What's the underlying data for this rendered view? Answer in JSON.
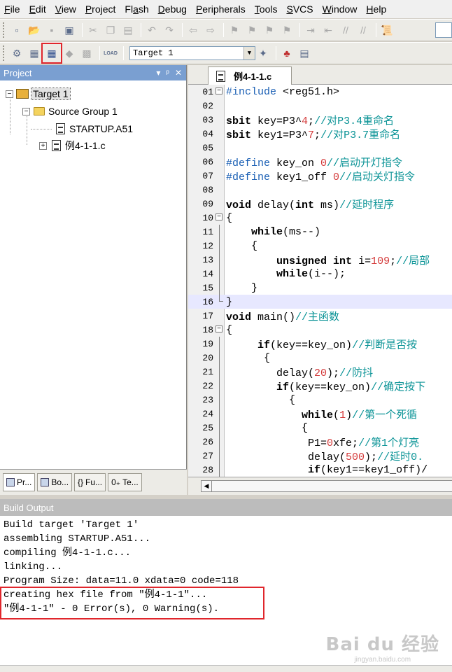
{
  "menu": [
    {
      "label": "File",
      "u": "F",
      "rest": "ile"
    },
    {
      "label": "Edit",
      "u": "E",
      "rest": "dit"
    },
    {
      "label": "View",
      "u": "V",
      "rest": "iew"
    },
    {
      "label": "Project",
      "u": "P",
      "rest": "roject"
    },
    {
      "label": "Flash",
      "u": "a",
      "pre": "Fl",
      "rest": "sh"
    },
    {
      "label": "Debug",
      "u": "D",
      "rest": "ebug"
    },
    {
      "label": "Peripherals",
      "u": "P",
      "rest": "eripherals"
    },
    {
      "label": "Tools",
      "u": "T",
      "rest": "ools"
    },
    {
      "label": "SVCS",
      "u": "S",
      "rest": "VCS"
    },
    {
      "label": "Window",
      "u": "W",
      "rest": "indow"
    },
    {
      "label": "Help",
      "u": "H",
      "rest": "elp"
    }
  ],
  "toolbar2": {
    "target": "Target 1",
    "load_label": "LOAD"
  },
  "project_panel": {
    "title": "Project",
    "tree": {
      "target": "Target 1",
      "group": "Source Group 1",
      "files": [
        "STARTUP.A51",
        "例4-1-1.c"
      ]
    },
    "tabs": [
      "Pr...",
      "Bo...",
      "Fu...",
      "Te..."
    ]
  },
  "editor": {
    "tab_label": "例4-1-1.c",
    "lines": [
      {
        "n": "01",
        "fold": "open",
        "code": "#include <reg51.h>"
      },
      {
        "n": "02",
        "fold": "",
        "code": ""
      },
      {
        "n": "03",
        "fold": "",
        "code": "sbit key=P3^4;//对P3.4重命名"
      },
      {
        "n": "04",
        "fold": "",
        "code": "sbit key1=P3^7;//对P3.7重命名"
      },
      {
        "n": "05",
        "fold": "",
        "code": ""
      },
      {
        "n": "06",
        "fold": "",
        "code": "#define key_on 0//启动开灯指令"
      },
      {
        "n": "07",
        "fold": "",
        "code": "#define key1_off 0//启动关灯指令"
      },
      {
        "n": "08",
        "fold": "",
        "code": ""
      },
      {
        "n": "09",
        "fold": "",
        "code": "void delay(int ms)//延时程序"
      },
      {
        "n": "10",
        "fold": "open",
        "code": "{"
      },
      {
        "n": "11",
        "fold": "bar",
        "code": "    while(ms--)"
      },
      {
        "n": "12",
        "fold": "bar",
        "code": "    {"
      },
      {
        "n": "13",
        "fold": "bar",
        "code": "        unsigned int i=109;//局部"
      },
      {
        "n": "14",
        "fold": "bar",
        "code": "        while(i--);"
      },
      {
        "n": "15",
        "fold": "bar",
        "code": "    }"
      },
      {
        "n": "16",
        "fold": "end",
        "code": "}"
      },
      {
        "n": "17",
        "fold": "",
        "code": "void main()//主函数"
      },
      {
        "n": "18",
        "fold": "open",
        "code": "{"
      },
      {
        "n": "19",
        "fold": "bar",
        "code": "     if(key==key_on)//判断是否按"
      },
      {
        "n": "20",
        "fold": "bar",
        "code": "      {"
      },
      {
        "n": "21",
        "fold": "bar",
        "code": "        delay(20);//防抖"
      },
      {
        "n": "22",
        "fold": "bar",
        "code": "        if(key==key_on)//确定按下"
      },
      {
        "n": "23",
        "fold": "bar",
        "code": "          {"
      },
      {
        "n": "24",
        "fold": "bar",
        "code": "            while(1)//第一个死循"
      },
      {
        "n": "25",
        "fold": "bar",
        "code": "            {"
      },
      {
        "n": "26",
        "fold": "bar",
        "code": "             P1=0xfe;//第1个灯亮"
      },
      {
        "n": "27",
        "fold": "bar",
        "code": "             delay(500);//延时0."
      },
      {
        "n": "28",
        "fold": "bar",
        "code": "             if(key1==key1_off)/"
      }
    ],
    "highlight_line": 8
  },
  "build_output": {
    "title": "Build Output",
    "lines": [
      "Build target 'Target 1'",
      "assembling STARTUP.A51...",
      "compiling 例4-1-1.c...",
      "linking...",
      "Program Size: data=11.0 xdata=0 code=118",
      "creating hex file from \"例4-1-1\"...",
      "\"例4-1-1\" - 0 Error(s), 0 Warning(s)."
    ]
  },
  "watermark": {
    "big": "Bai du 经验",
    "small": "jingyan.baidu.com"
  },
  "colors": {
    "highlight_box": "#e0262c",
    "panel_title": "#7a9fd1",
    "comment": "#0a9396"
  }
}
